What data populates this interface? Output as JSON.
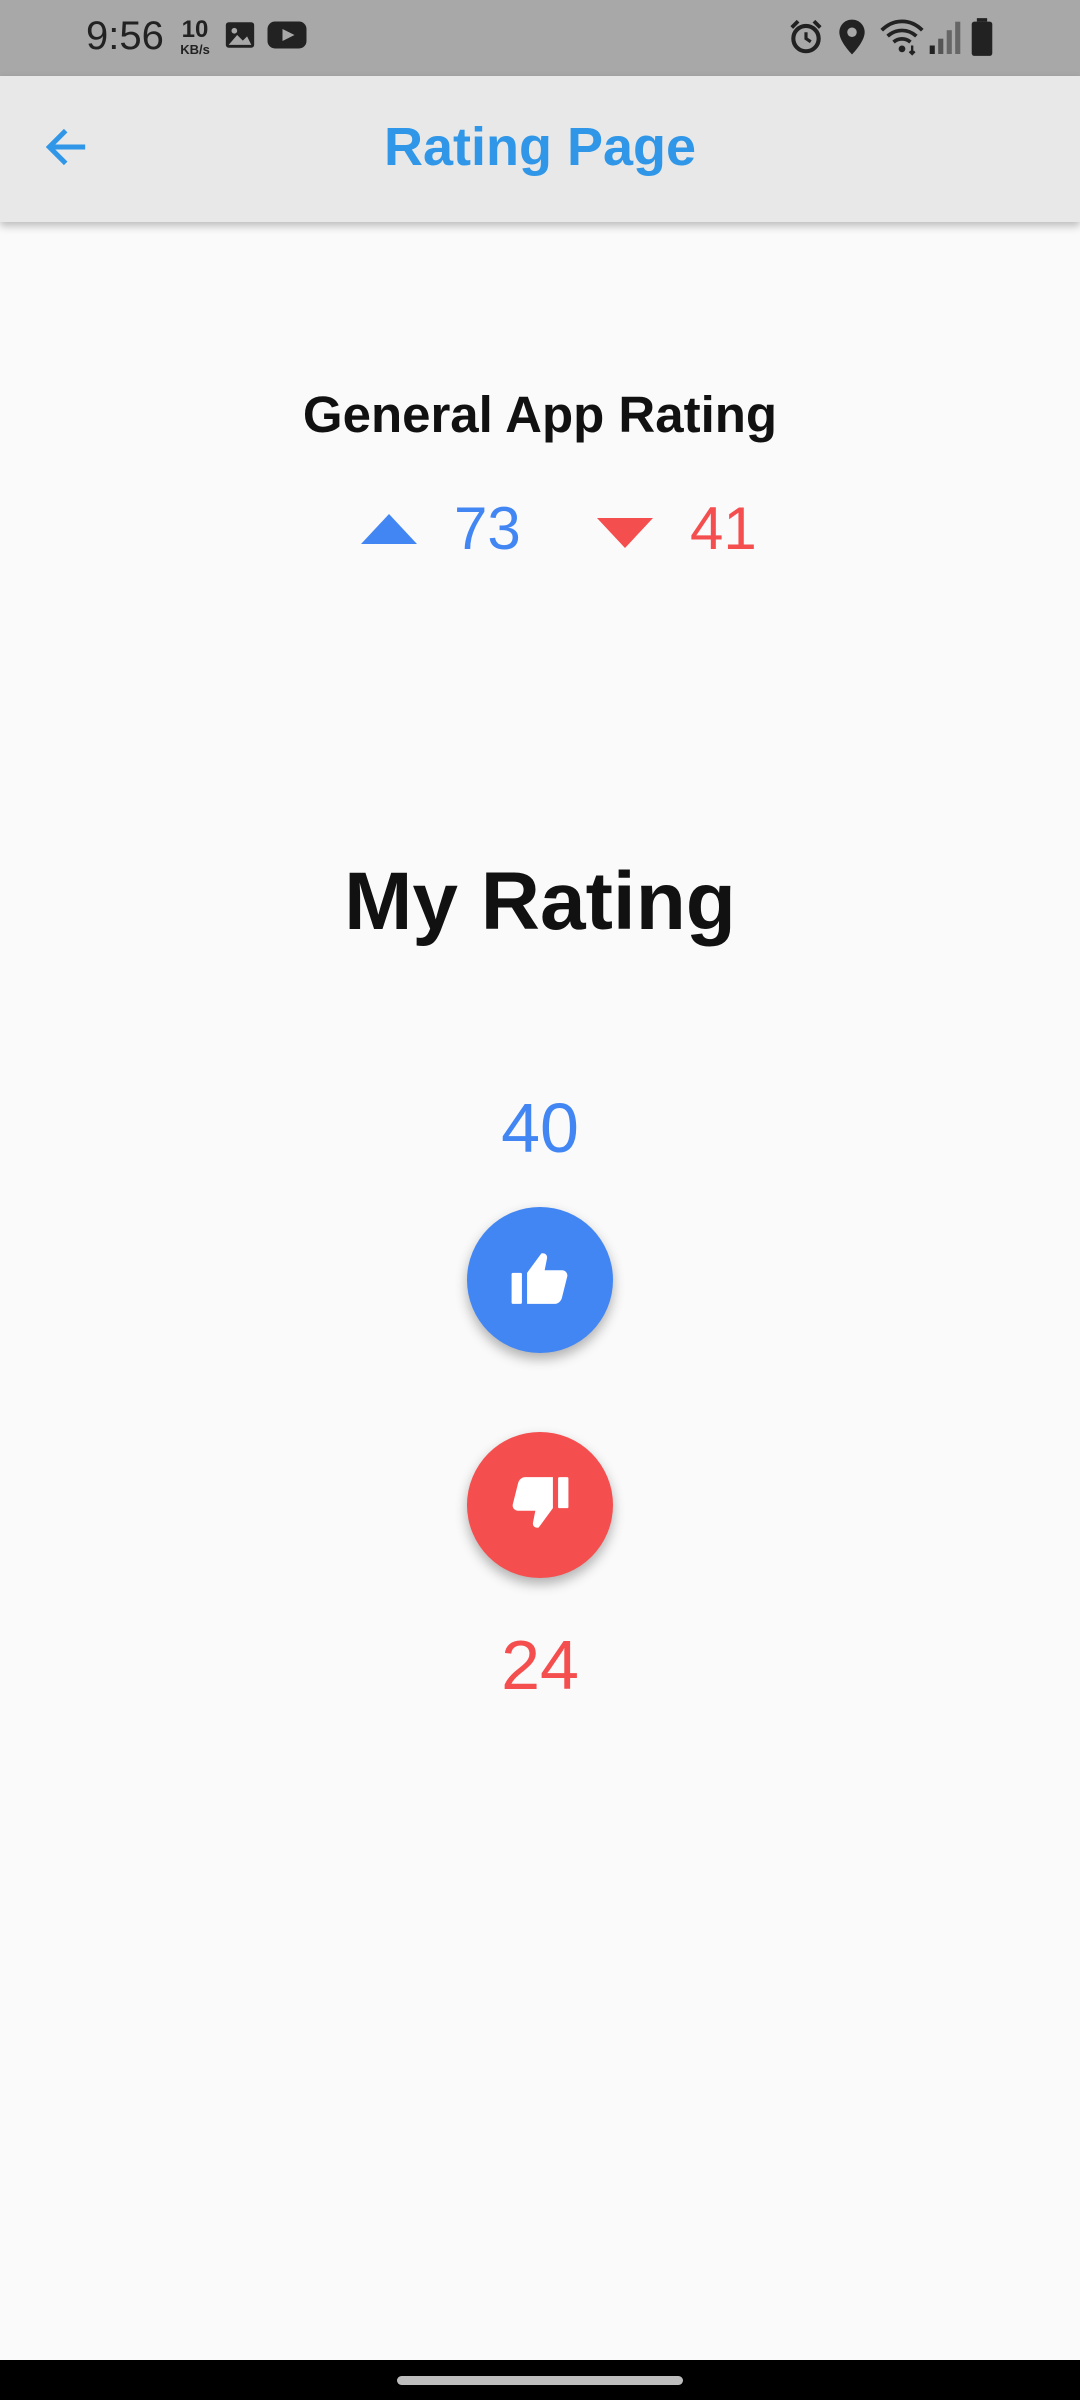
{
  "status_bar": {
    "time": "9:56",
    "net_speed_value": "10",
    "net_speed_unit": "KB/s",
    "left_icons": [
      "image-icon",
      "youtube-icon"
    ],
    "right_icons": [
      "alarm-icon",
      "location-icon",
      "wifi-icon",
      "signal-icon",
      "battery-icon"
    ]
  },
  "app_bar": {
    "title": "Rating Page",
    "back_icon": "arrow-back-icon"
  },
  "general_rating": {
    "title": "General App Rating",
    "up_count": "73",
    "down_count": "41"
  },
  "my_rating": {
    "title": "My Rating",
    "like_count": "40",
    "dislike_count": "24",
    "like_icon": "thumb-up-icon",
    "dislike_icon": "thumb-down-icon"
  },
  "colors": {
    "accent": "#2f96e8",
    "like": "#4286f4",
    "dislike": "#f44e4e",
    "background": "#fafafa",
    "app_bar": "#e8e8e8",
    "status_bar": "#a8a8a8"
  }
}
